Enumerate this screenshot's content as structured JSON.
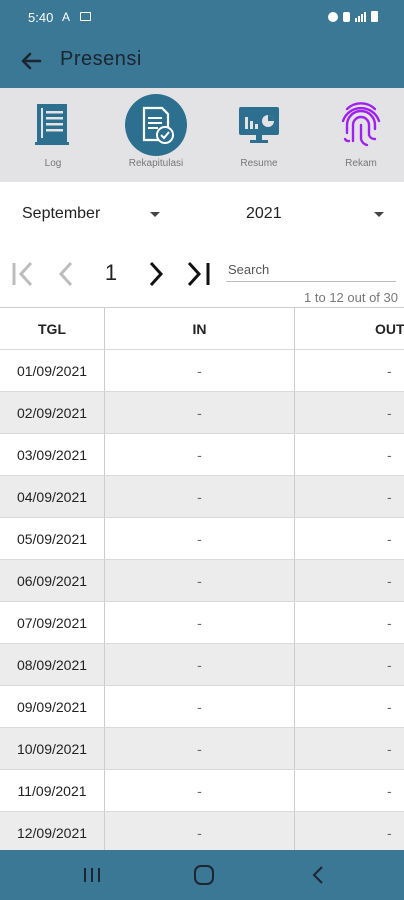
{
  "status": {
    "time": "5:40",
    "a_label": "A"
  },
  "appbar": {
    "title": "Presensi"
  },
  "menu": [
    {
      "label": "Log",
      "icon": "log-icon"
    },
    {
      "label": "Rekapitulasi",
      "icon": "rekap-icon",
      "active": true
    },
    {
      "label": "Resume",
      "icon": "resume-icon"
    },
    {
      "label": "Rekam",
      "icon": "fingerprint-icon"
    }
  ],
  "filters": {
    "month": "September",
    "year": "2021"
  },
  "pager": {
    "page": "1",
    "search_placeholder": "Search",
    "range": "1 to 12 out of 30"
  },
  "table": {
    "headers": {
      "tgl": "TGL",
      "in": "IN",
      "out": "OUT"
    },
    "rows": [
      {
        "tgl": "01/09/2021",
        "in": "-",
        "out": "-"
      },
      {
        "tgl": "02/09/2021",
        "in": "-",
        "out": "-"
      },
      {
        "tgl": "03/09/2021",
        "in": "-",
        "out": "-"
      },
      {
        "tgl": "04/09/2021",
        "in": "-",
        "out": "-"
      },
      {
        "tgl": "05/09/2021",
        "in": "-",
        "out": "-"
      },
      {
        "tgl": "06/09/2021",
        "in": "-",
        "out": "-"
      },
      {
        "tgl": "07/09/2021",
        "in": "-",
        "out": "-"
      },
      {
        "tgl": "08/09/2021",
        "in": "-",
        "out": "-"
      },
      {
        "tgl": "09/09/2021",
        "in": "-",
        "out": "-"
      },
      {
        "tgl": "10/09/2021",
        "in": "-",
        "out": "-"
      },
      {
        "tgl": "11/09/2021",
        "in": "-",
        "out": "-"
      },
      {
        "tgl": "12/09/2021",
        "in": "-",
        "out": "-"
      }
    ]
  },
  "colors": {
    "primary": "#3a7896",
    "active_icon_bg": "#2c6f8f",
    "fingerprint": "#a020f0",
    "menu_bg": "#e3e3e6"
  }
}
